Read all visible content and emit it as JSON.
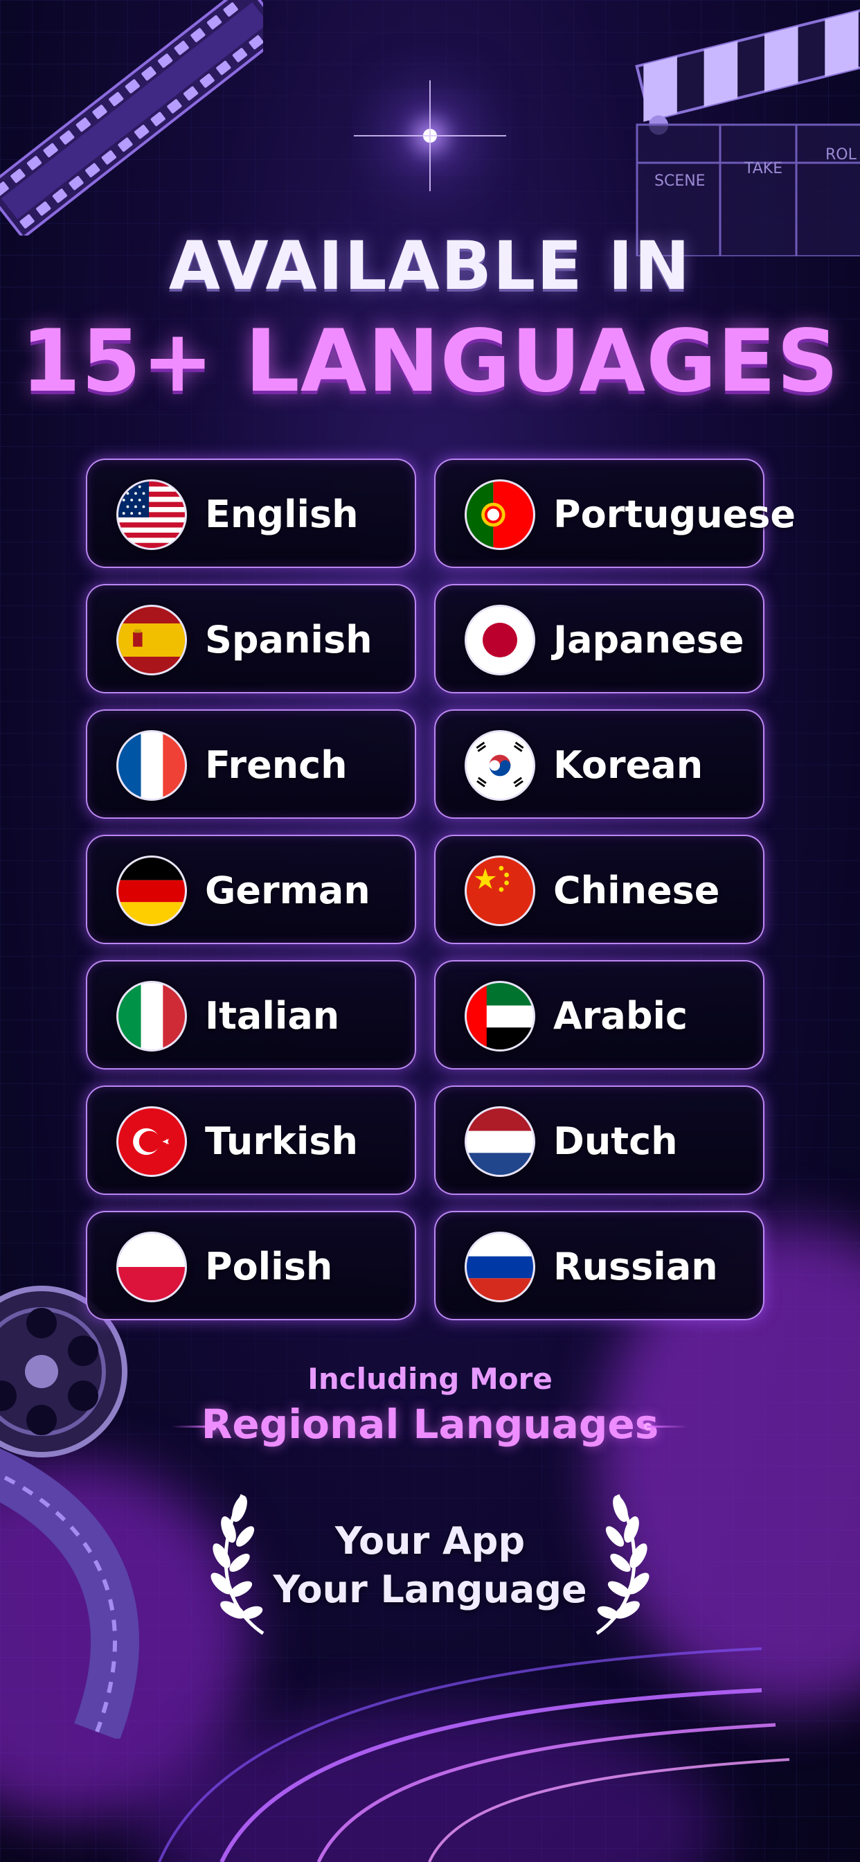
{
  "heading": {
    "line1": "AVAILABLE IN",
    "line2": "15+ LANGUAGES"
  },
  "clapperboard": {
    "scene": "SCENE",
    "take": "TAKE",
    "roll": "ROL"
  },
  "languages": [
    {
      "label": "English",
      "flag": "us-flag-icon"
    },
    {
      "label": "Portuguese",
      "flag": "portugal-flag-icon"
    },
    {
      "label": "Spanish",
      "flag": "spain-flag-icon"
    },
    {
      "label": "Japanese",
      "flag": "japan-flag-icon"
    },
    {
      "label": "French",
      "flag": "france-flag-icon"
    },
    {
      "label": "Korean",
      "flag": "korea-flag-icon"
    },
    {
      "label": "German",
      "flag": "germany-flag-icon"
    },
    {
      "label": "Chinese",
      "flag": "china-flag-icon"
    },
    {
      "label": "Italian",
      "flag": "italy-flag-icon"
    },
    {
      "label": "Arabic",
      "flag": "uae-flag-icon"
    },
    {
      "label": "Turkish",
      "flag": "turkey-flag-icon"
    },
    {
      "label": "Dutch",
      "flag": "netherlands-flag-icon"
    },
    {
      "label": "Polish",
      "flag": "poland-flag-icon"
    },
    {
      "label": "Russian",
      "flag": "russia-flag-icon"
    }
  ],
  "more": {
    "line1": "Including More",
    "line2": "Regional Languages"
  },
  "tagline": {
    "line1": "Your App",
    "line2": "Your Language"
  },
  "colors": {
    "background": "#0a0626",
    "accent_purple": "#c68eff",
    "heading_pink": "#f08cff",
    "text": "#ffffff"
  }
}
